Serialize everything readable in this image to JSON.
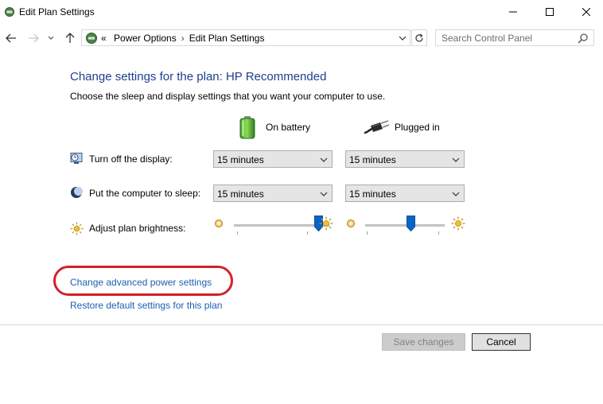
{
  "window": {
    "title": "Edit Plan Settings"
  },
  "nav": {
    "breadcrumb_prefix": "«",
    "breadcrumb": [
      "Power Options",
      "Edit Plan Settings"
    ],
    "breadcrumb_separator": "›",
    "search_placeholder": "Search Control Panel"
  },
  "content": {
    "heading": "Change settings for the plan: HP Recommended",
    "subtitle": "Choose the sleep and display settings that you want your computer to use.",
    "columns": {
      "battery": "On battery",
      "plugged": "Plugged in"
    },
    "rows": {
      "display": {
        "label": "Turn off the display:",
        "battery_value": "15 minutes",
        "plugged_value": "15 minutes"
      },
      "sleep": {
        "label": "Put the computer to sleep:",
        "battery_value": "15 minutes",
        "plugged_value": "15 minutes"
      },
      "brightness": {
        "label": "Adjust plan brightness:",
        "battery_level": 0.93,
        "plugged_level": 0.58
      }
    },
    "links": {
      "advanced": "Change advanced power settings",
      "restore": "Restore default settings for this plan"
    }
  },
  "footer": {
    "save_label": "Save changes",
    "cancel_label": "Cancel"
  },
  "colors": {
    "heading": "#1e3f8c",
    "link": "#1a5fb4",
    "highlight_ring": "#d4202a",
    "slider_thumb": "#0a64c8"
  }
}
